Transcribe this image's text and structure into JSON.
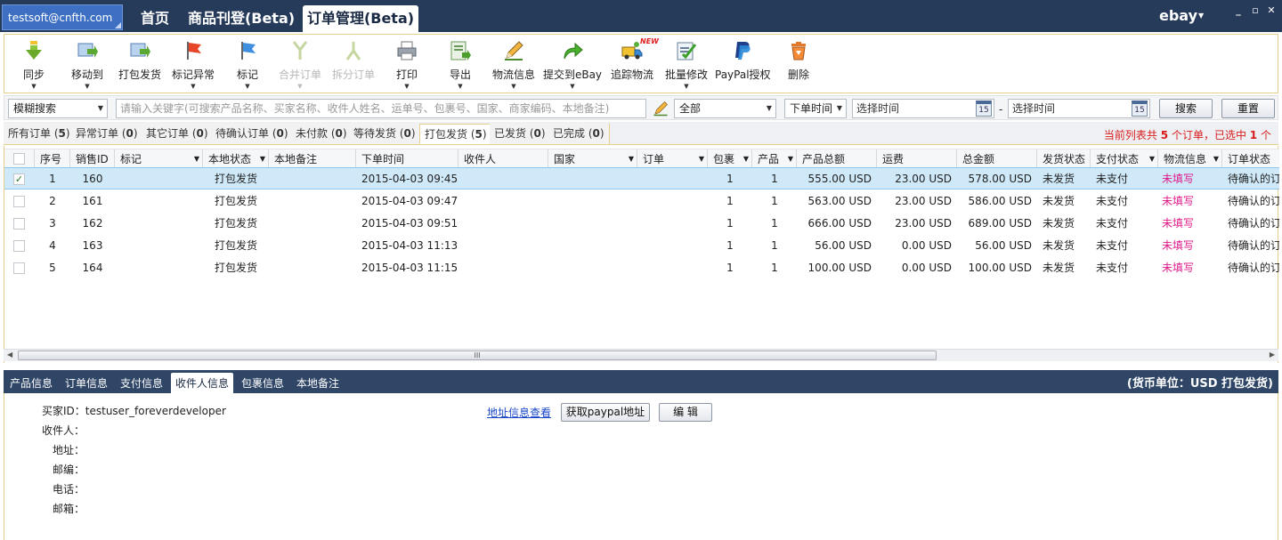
{
  "titlebar": {
    "account": "testsoft@cnfth.com",
    "tabs": [
      {
        "label": "首页"
      },
      {
        "label": "商品刊登(Beta)"
      },
      {
        "label": "订单管理(Beta)"
      }
    ],
    "brand": "ebay",
    "window_buttons": {
      "minimize": "_",
      "restore": "▫",
      "close": "✕"
    }
  },
  "toolbar": {
    "items": [
      {
        "label": "同步",
        "icon": "sync-down-arrow-icon",
        "dropdown": "▼"
      },
      {
        "label": "移动到",
        "icon": "move-folder-icon",
        "dropdown": "▼"
      },
      {
        "label": "打包发货",
        "icon": "pack-ship-icon"
      },
      {
        "label": "标记异常",
        "icon": "red-flag-icon",
        "dropdown": "▼"
      },
      {
        "label": "标记",
        "icon": "blue-flag-icon",
        "dropdown": "▼"
      },
      {
        "label": "合并订单",
        "icon": "merge-icon",
        "dropdown": "▼",
        "disabled": true
      },
      {
        "label": "拆分订单",
        "icon": "split-icon",
        "disabled": true
      },
      {
        "label": "打印",
        "icon": "printer-icon",
        "dropdown": "▼"
      },
      {
        "label": "导出",
        "icon": "export-icon",
        "dropdown": "▼"
      },
      {
        "label": "物流信息",
        "icon": "pencil-edit-icon",
        "dropdown": "▼"
      },
      {
        "label": "提交到eBay",
        "icon": "submit-arrow-icon",
        "dropdown": "▼"
      },
      {
        "label": "追踪物流",
        "icon": "truck-icon",
        "badge": "NEW"
      },
      {
        "label": "批量修改",
        "icon": "batch-edit-icon",
        "dropdown": "▼"
      },
      {
        "label": "PayPal授权",
        "icon": "paypal-icon"
      },
      {
        "label": "删除",
        "icon": "trash-icon"
      }
    ]
  },
  "search": {
    "mode": "模糊搜索",
    "placeholder": "请输入关键字(可搜索产品名称、买家名称、收件人姓名、运单号、包裹号、国家、商家编码、本地备注)",
    "scope": "全部",
    "time_field": "下单时间",
    "start_placeholder": "选择时间",
    "end_placeholder": "选择时间",
    "separator": "-",
    "calendar_day": "15",
    "search_label": "搜索",
    "reset_label": "重置"
  },
  "filters": {
    "tabs": [
      {
        "label": "所有订单",
        "count": "5"
      },
      {
        "label": "异常订单",
        "count": "0"
      },
      {
        "label": "其它订单",
        "count": "0"
      },
      {
        "label": "待确认订单",
        "count": "0"
      },
      {
        "label": "未付款",
        "count": "0"
      },
      {
        "label": "等待发货",
        "count": "0"
      },
      {
        "label": "打包发货",
        "count": "5"
      },
      {
        "label": "已发货",
        "count": "0"
      },
      {
        "label": "已完成",
        "count": "0"
      }
    ],
    "summary_prefix": "当前列表共",
    "summary_total": "5",
    "summary_mid": "个订单，已选中",
    "summary_selected": "1",
    "summary_suffix": "个"
  },
  "grid": {
    "columns": [
      "序号",
      "销售ID",
      "标记",
      "本地状态",
      "本地备注",
      "下单时间",
      "收件人",
      "国家",
      "订单",
      "包裹",
      "产品",
      "产品总额",
      "运费",
      "总金额",
      "发货状态",
      "支付状态",
      "物流信息",
      "订单状态"
    ],
    "rows": [
      {
        "idx": "1",
        "sale_id": "160",
        "local_status": "打包发货",
        "order_time": "2015-04-03 09:45",
        "packages": "1",
        "products": "1",
        "product_total": "555.00 USD",
        "shipping": "23.00 USD",
        "total": "578.00 USD",
        "ship_status": "未发货",
        "pay_status": "未支付",
        "logistics": "未填写",
        "order_status": "待确认的订",
        "selected": true
      },
      {
        "idx": "2",
        "sale_id": "161",
        "local_status": "打包发货",
        "order_time": "2015-04-03 09:47",
        "packages": "1",
        "products": "1",
        "product_total": "563.00 USD",
        "shipping": "23.00 USD",
        "total": "586.00 USD",
        "ship_status": "未发货",
        "pay_status": "未支付",
        "logistics": "未填写",
        "order_status": "待确认的订"
      },
      {
        "idx": "3",
        "sale_id": "162",
        "local_status": "打包发货",
        "order_time": "2015-04-03 09:51",
        "packages": "1",
        "products": "1",
        "product_total": "666.00 USD",
        "shipping": "23.00 USD",
        "total": "689.00 USD",
        "ship_status": "未发货",
        "pay_status": "未支付",
        "logistics": "未填写",
        "order_status": "待确认的订"
      },
      {
        "idx": "4",
        "sale_id": "163",
        "local_status": "打包发货",
        "order_time": "2015-04-03 11:13",
        "packages": "1",
        "products": "1",
        "product_total": "56.00 USD",
        "shipping": "0.00 USD",
        "total": "56.00 USD",
        "ship_status": "未发货",
        "pay_status": "未支付",
        "logistics": "未填写",
        "order_status": "待确认的订"
      },
      {
        "idx": "5",
        "sale_id": "164",
        "local_status": "打包发货",
        "order_time": "2015-04-03 11:15",
        "packages": "1",
        "products": "1",
        "product_total": "100.00 USD",
        "shipping": "0.00 USD",
        "total": "100.00 USD",
        "ship_status": "未发货",
        "pay_status": "未支付",
        "logistics": "未填写",
        "order_status": "待确认的订"
      }
    ],
    "check_mark": "✓",
    "scroll_grip": "III",
    "scroll_left": "◀",
    "scroll_right": "▶"
  },
  "detail": {
    "tabs": [
      {
        "label": "产品信息"
      },
      {
        "label": "订单信息"
      },
      {
        "label": "支付信息"
      },
      {
        "label": "收件人信息"
      },
      {
        "label": "包裹信息"
      },
      {
        "label": "本地备注"
      }
    ],
    "currency_info": "(货币单位：USD 打包发货)",
    "buyer_id": "买家ID：testuser_foreverdeveloper",
    "recipient": "收件人：",
    "address": "地址：",
    "zip": "邮编：",
    "phone": "电话：",
    "email": "邮箱：",
    "address_link": "地址信息查看",
    "paypal_button": "获取paypal地址",
    "edit_button": "编 辑"
  },
  "colors": {
    "titlebar_bg": "#263a5a",
    "account_bg": "#3d6fc2",
    "selected_row": "#cfe9f9",
    "alert_red": "#d81c1c",
    "logistics_pink": "#e0198a",
    "link_blue": "#1a47c8"
  }
}
